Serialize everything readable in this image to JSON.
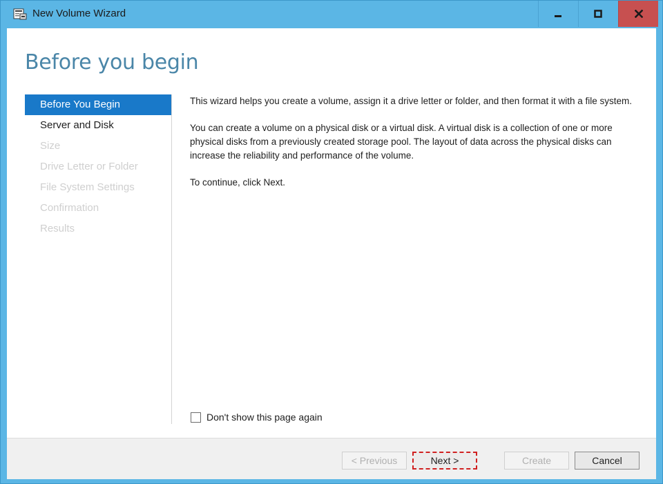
{
  "window": {
    "title": "New Volume Wizard",
    "minimize_icon": "minimize-icon",
    "maximize_icon": "maximize-icon",
    "close_icon": "close-icon",
    "close_color": "#c75050",
    "titlebar_color": "#5bb6e5"
  },
  "page": {
    "title": "Before you begin"
  },
  "nav": {
    "active_color": "#1979c9",
    "items": [
      {
        "label": "Before You Begin",
        "state": "active"
      },
      {
        "label": "Server and Disk",
        "state": "enabled"
      },
      {
        "label": "Size",
        "state": "disabled"
      },
      {
        "label": "Drive Letter or Folder",
        "state": "disabled"
      },
      {
        "label": "File System Settings",
        "state": "disabled"
      },
      {
        "label": "Confirmation",
        "state": "disabled"
      },
      {
        "label": "Results",
        "state": "disabled"
      }
    ]
  },
  "content": {
    "paragraphs": [
      "This wizard helps you create a volume, assign it a drive letter or folder, and then format it with a file system.",
      "You can create a volume on a physical disk or a virtual disk. A virtual disk is a collection of one or more physical disks from a previously created storage pool. The layout of data across the physical disks can increase the reliability and performance of the volume.",
      "To continue, click Next."
    ]
  },
  "dont_show": {
    "label": "Don't show this page again",
    "checked": false
  },
  "footer": {
    "previous_label": "< Previous",
    "next_label": "Next >",
    "create_label": "Create",
    "cancel_label": "Cancel"
  }
}
